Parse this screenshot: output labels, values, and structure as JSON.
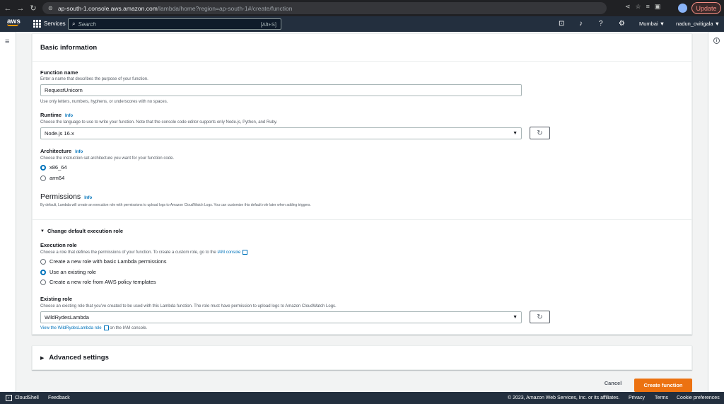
{
  "browser": {
    "url_host": "ap-south-1.console.aws.amazon.com",
    "url_path": "/lambda/home?region=ap-south-1#/create/function",
    "update_label": "Update"
  },
  "aws_nav": {
    "logo": "aws",
    "services_label": "Services",
    "search_placeholder": "Search",
    "search_shortcut": "[Alt+S]",
    "region": "Mumbai ▼",
    "user": "nadun_ovitigala ▼"
  },
  "basic_info": {
    "title": "Basic information",
    "function_name": {
      "label": "Function name",
      "description": "Enter a name that describes the purpose of your function.",
      "value": "RequestUnicorn",
      "hint": "Use only letters, numbers, hyphens, or underscores with no spaces."
    },
    "runtime": {
      "label": "Runtime",
      "info": "Info",
      "description": "Choose the language to use to write your function. Note that the console code editor supports only Node.js, Python, and Ruby.",
      "value": "Node.js 16.x"
    },
    "architecture": {
      "label": "Architecture",
      "info": "Info",
      "description": "Choose the instruction set architecture you want for your function code.",
      "options": [
        "x86_64",
        "arm64"
      ],
      "selected": "x86_64"
    },
    "permissions": {
      "title": "Permissions",
      "info": "Info",
      "description": "By default, Lambda will create an execution role with permissions to upload logs to Amazon CloudWatch Logs. You can customize this default role later when adding triggers."
    },
    "execution_role_toggle": "Change default execution role",
    "execution_role": {
      "label": "Execution role",
      "description": "Choose a role that defines the permissions of your function. To create a custom role, go to the",
      "iam_link": "IAM console",
      "options": [
        "Create a new role with basic Lambda permissions",
        "Use an existing role",
        "Create a new role from AWS policy templates"
      ],
      "selected": "Use an existing role"
    },
    "existing_role": {
      "label": "Existing role",
      "description": "Choose an existing role that you've created to be used with this Lambda function. The role must have permission to upload logs to Amazon CloudWatch Logs.",
      "value": "WildRydesLambda",
      "view_link": "View the WildRydesLambda role",
      "view_suffix": "on the IAM console."
    }
  },
  "advanced": {
    "title": "Advanced settings"
  },
  "actions": {
    "cancel": "Cancel",
    "create": "Create function"
  },
  "footer": {
    "cloudshell": "CloudShell",
    "feedback": "Feedback",
    "copyright": "© 2023, Amazon Web Services, Inc. or its affiliates.",
    "privacy": "Privacy",
    "terms": "Terms",
    "cookie": "Cookie preferences"
  },
  "colors": {
    "accent": "#0073bb",
    "primary_button": "#ec7211",
    "nav": "#232f3e"
  }
}
